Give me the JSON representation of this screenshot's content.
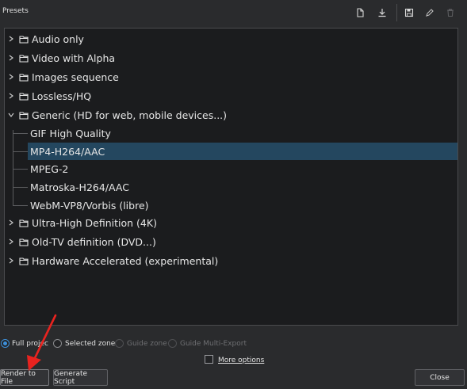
{
  "panel": {
    "title": "Presets"
  },
  "toolbar": {
    "icons": [
      "new-preset-icon",
      "download-icon",
      "save-preset-icon",
      "edit-preset-icon",
      "delete-preset-icon"
    ]
  },
  "tree": {
    "items": [
      {
        "label": "Audio only",
        "type": "folder",
        "expanded": false
      },
      {
        "label": "Video with Alpha",
        "type": "folder",
        "expanded": false
      },
      {
        "label": "Images sequence",
        "type": "folder",
        "expanded": false
      },
      {
        "label": "Lossless/HQ",
        "type": "folder",
        "expanded": false
      },
      {
        "label": "Generic (HD for web, mobile devices...)",
        "type": "folder",
        "expanded": true,
        "children": [
          {
            "label": "GIF High Quality",
            "selected": false
          },
          {
            "label": "MP4-H264/AAC",
            "selected": true
          },
          {
            "label": "MPEG-2",
            "selected": false
          },
          {
            "label": "Matroska-H264/AAC",
            "selected": false
          },
          {
            "label": "WebM-VP8/Vorbis (libre)",
            "selected": false
          }
        ]
      },
      {
        "label": "Ultra-High Definition (4K)",
        "type": "folder",
        "expanded": false
      },
      {
        "label": "Old-TV definition (DVD...)",
        "type": "folder",
        "expanded": false
      },
      {
        "label": "Hardware Accelerated (experimental)",
        "type": "folder",
        "expanded": false
      }
    ]
  },
  "range": {
    "options": [
      {
        "label": "Full projec",
        "selected": true,
        "enabled": true
      },
      {
        "label": "Selected zone",
        "selected": false,
        "enabled": true
      },
      {
        "label": "Guide zone",
        "selected": false,
        "enabled": false
      },
      {
        "label": "Guide Multi-Export",
        "selected": false,
        "enabled": false
      }
    ]
  },
  "more_options": {
    "label": "More options",
    "checked": false
  },
  "buttons": {
    "render": "Render to File",
    "script": "Generate Script",
    "close": "Close"
  },
  "colors": {
    "accent": "#3d8fd8",
    "selection": "#24475f",
    "annotation_arrow": "#e8231f"
  }
}
